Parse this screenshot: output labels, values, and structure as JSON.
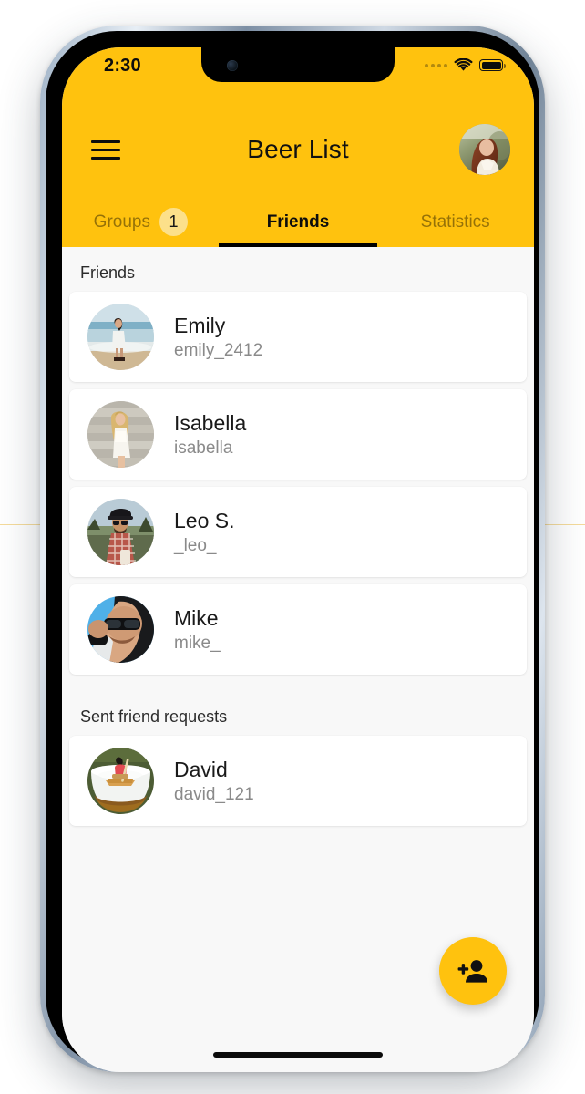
{
  "status_bar": {
    "time": "2:30",
    "signal_icon": "signal-dots-icon",
    "wifi_icon": "wifi-icon",
    "battery_icon": "battery-full-icon"
  },
  "header": {
    "menu_icon": "hamburger-menu-icon",
    "title": "Beer List",
    "profile_avatar": "user-profile-avatar",
    "background_color": "#FFC20E"
  },
  "tabs": [
    {
      "label": "Groups",
      "active": false,
      "badge": "1"
    },
    {
      "label": "Friends",
      "active": true,
      "badge": null
    },
    {
      "label": "Statistics",
      "active": false,
      "badge": null
    }
  ],
  "sections": [
    {
      "title": "Friends",
      "rows": [
        {
          "name": "Emily",
          "handle": "emily_2412",
          "avatar": "avatar-emily-beach"
        },
        {
          "name": "Isabella",
          "handle": "isabella",
          "avatar": "avatar-isabella-wall"
        },
        {
          "name": "Leo S.",
          "handle": "_leo_",
          "avatar": "avatar-leo-hat"
        },
        {
          "name": "Mike",
          "handle": "mike_",
          "avatar": "avatar-mike-sunglasses"
        }
      ]
    },
    {
      "title": "Sent friend requests",
      "rows": [
        {
          "name": "David",
          "handle": "david_121",
          "avatar": "avatar-david-beer-rowing"
        }
      ]
    }
  ],
  "fab": {
    "icon": "person-add-icon",
    "color": "#FFC20E"
  },
  "colors": {
    "accent": "#FFC20E",
    "badge": "#FCE08A",
    "page_background": "#F8F8F8",
    "card_background": "#FFFFFF",
    "primary_text": "#1A1A1A",
    "secondary_text": "#8A8A8A",
    "inactive_tab_text": "#8A7300"
  }
}
